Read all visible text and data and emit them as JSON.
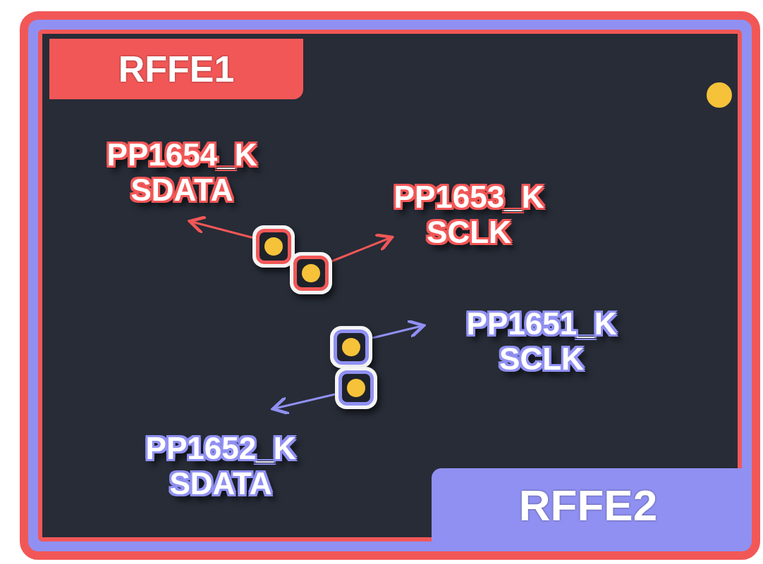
{
  "groups": [
    {
      "label": "RFFE1",
      "color": "#f25757"
    },
    {
      "label": "RFFE2",
      "color": "#9090f2"
    }
  ],
  "nets": [
    {
      "name": "PP1654_K",
      "signal": "SDATA",
      "color": "#f25757"
    },
    {
      "name": "PP1653_K",
      "signal": "SCLK",
      "color": "#f25757"
    },
    {
      "name": "PP1651_K",
      "signal": "SCLK",
      "color": "#9090f2"
    },
    {
      "name": "PP1652_K",
      "signal": "SDATA",
      "color": "#9090f2"
    }
  ]
}
